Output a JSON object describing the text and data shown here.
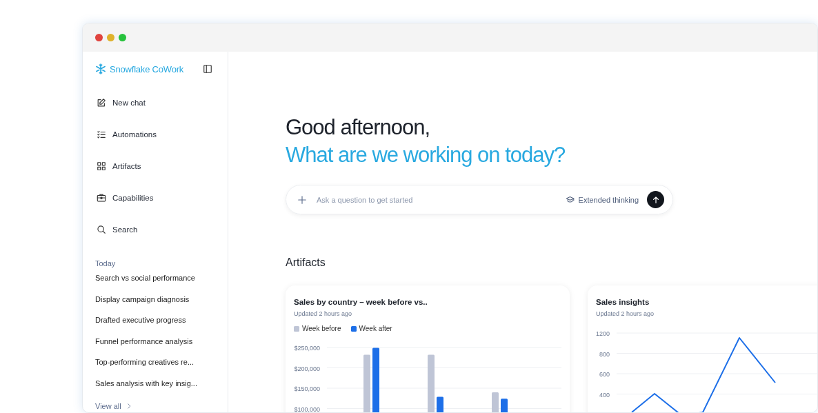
{
  "sidebar": {
    "logo": "Snowflake CoWork",
    "nav": [
      "New chat",
      "Automations",
      "Artifacts",
      "Capabilities",
      "Search"
    ],
    "section_title": "Today",
    "history": [
      "Search vs social performance",
      "Display campaign diagnosis",
      "Drafted executive progress",
      "Funnel performance analysis",
      "Top-performing creatives re...",
      "Sales analysis with key insig..."
    ],
    "view_all": "View all"
  },
  "greeting": {
    "line_1": "Good afternoon,",
    "line_2": "What are we working on today?"
  },
  "prompt": {
    "placeholder": "Ask a question to get started",
    "extended_thinking": "Extended thinking"
  },
  "artifacts": {
    "title": "Artifacts",
    "cards": [
      {
        "title": "Sales by country – week before vs..",
        "updated": "Updated 2 hours ago",
        "chart_data": {
          "type": "bar",
          "grid": true,
          "ylim": [
            0,
            250000
          ],
          "yticks": [
            {
              "value": 250000,
              "label": "$250,000"
            },
            {
              "value": 200000,
              "label": "$200,000"
            },
            {
              "value": 150000,
              "label": "$150,000"
            },
            {
              "value": 100000,
              "label": "$100,000"
            }
          ],
          "series": [
            {
              "name": "Week before",
              "color": "#bfc5d6",
              "values": [
                232000,
                232000,
                140000
              ]
            },
            {
              "name": "Week after",
              "color": "#1d6fe8",
              "values": [
                249000,
                129000,
                124000
              ]
            }
          ]
        }
      },
      {
        "title": "Sales insights",
        "updated": "Updated 2 hours ago",
        "axis_labels": [
          "1200",
          "800",
          "600",
          "400"
        ]
      }
    ]
  }
}
